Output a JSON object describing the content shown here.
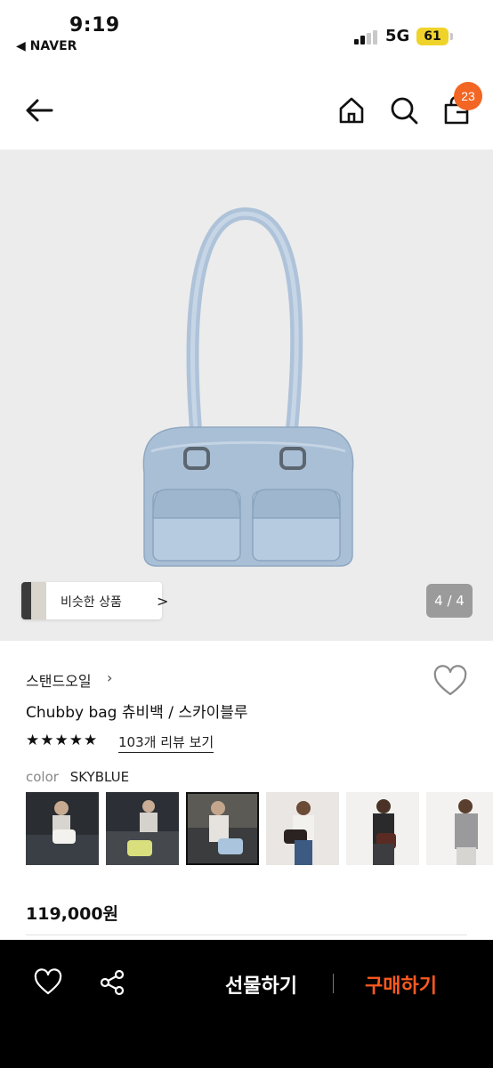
{
  "status_bar": {
    "time": "9:19",
    "back_app": "◀ NAVER",
    "network": "5G",
    "battery": "61"
  },
  "header": {
    "cart_count": "23",
    "icons": [
      "back-arrow-icon",
      "home-icon",
      "search-icon",
      "shopping-bag-icon"
    ]
  },
  "hero": {
    "similar_label": "비슷한 상품",
    "similar_chevron": ">",
    "pager": "4 / 4"
  },
  "product": {
    "brand": "스탠드오일",
    "brand_chevron": "›",
    "title": "Chubby bag 츄비백 / 스카이블루",
    "rating_stars": "★★★★★",
    "rating": 5,
    "review_link": "103개 리뷰 보기",
    "color_label": "color",
    "color_value": "SKYBLUE",
    "selected_swatch_index": 2,
    "price": "119,000원"
  },
  "bottom_bar": {
    "gift_label": "선물하기",
    "buy_label": "구매하기"
  },
  "colors": {
    "accent": "#f26522",
    "buy": "#ff5a1f",
    "bar_bg": "#000000",
    "bag_blue": "#a9bfd6"
  }
}
